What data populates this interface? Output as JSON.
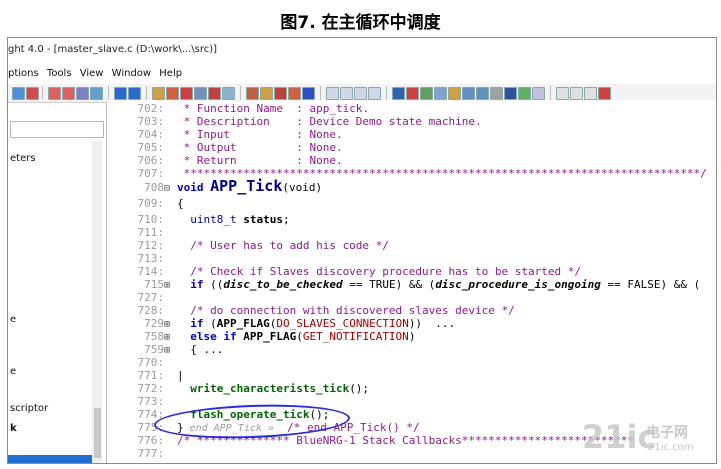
{
  "figure_caption": "图7. 在主循环中调度",
  "window": {
    "title": "ght 4.0 - [master_slave.c (D:\\work\\...\\src)]"
  },
  "menu": [
    "ptions",
    "Tools",
    "View",
    "Window",
    "Help"
  ],
  "sidebar": {
    "labels": [
      "eters",
      "e",
      "e",
      "scriptor",
      "k"
    ]
  },
  "code_lines": [
    {
      "num": "702:",
      "fold": "",
      "text": " * Function Name  : app_tick."
    },
    {
      "num": "703:",
      "fold": "",
      "text": " * Description    : Device Demo state machine."
    },
    {
      "num": "704:",
      "fold": "",
      "text": " * Input          : None."
    },
    {
      "num": "705:",
      "fold": "",
      "text": " * Output         : None."
    },
    {
      "num": "706:",
      "fold": "",
      "text": " * Return         : None."
    },
    {
      "num": "707:",
      "fold": "",
      "text": " ******************************************************************************/"
    },
    {
      "num": "708",
      "fold": "⊟",
      "pre": "void ",
      "fn": "APP_Tick",
      "post": "(void)"
    },
    {
      "num": "709:",
      "fold": "",
      "text": "{"
    },
    {
      "num": "710:",
      "fold": "",
      "pre": "  uint8_t ",
      "bold": "status",
      "post": ";"
    },
    {
      "num": "711:",
      "fold": "",
      "text": ""
    },
    {
      "num": "712:",
      "fold": "",
      "text": "  /* User has to add his code */"
    },
    {
      "num": "713:",
      "fold": "",
      "text": ""
    },
    {
      "num": "714:",
      "fold": "",
      "text": "  /* Check if Slaves discovery procedure has to be started */"
    },
    {
      "num": "715",
      "fold": "⊞",
      "kw": "  if ",
      "a": "((",
      "it1": "disc_to_be_checked",
      "b": " == TRUE) && (",
      "it2": "disc_procedure_is_ongoing",
      "c": " == FALSE) && ("
    },
    {
      "num": "727:",
      "fold": "",
      "text": ""
    },
    {
      "num": "728:",
      "fold": "",
      "text": "  /* do connection with discovered slaves device */"
    },
    {
      "num": "729",
      "fold": "⊞",
      "kw": "  if ",
      "a": "(",
      "fn1": "APP_FLAG",
      "b": "(",
      "mac1": "DO_SLAVES_CONNECTION",
      "c": "))  ..."
    },
    {
      "num": "758",
      "fold": "⊞",
      "kw": "  else if ",
      "fn1": "APP_FLAG",
      "b": "(",
      "mac1": "GET_NOTIFICATION",
      "c": ")"
    },
    {
      "num": "759",
      "fold": "⊞",
      "text": "  { ..."
    },
    {
      "num": "770:",
      "fold": "",
      "text": ""
    },
    {
      "num": "771:",
      "fold": "",
      "text": "|"
    },
    {
      "num": "772:",
      "fold": "",
      "green": "  write_characterists_tick",
      "post": "();"
    },
    {
      "num": "773:",
      "fold": "",
      "text": ""
    },
    {
      "num": "774:",
      "fold": "",
      "green": "  flash_operate_tick",
      "post": "();"
    },
    {
      "num": "775:",
      "fold": "",
      "text": "}",
      "ann": " end APP_Tick »",
      "cm2": "  /* end APP_Tick() */"
    },
    {
      "num": "776:",
      "fold": "",
      "text": "/* ************** BlueNRG-1 Stack Callbacks**************************"
    },
    {
      "num": "777:",
      "fold": "",
      "text": ""
    }
  ],
  "watermark": {
    "main": "21ic",
    "sub": "电子网",
    "small": "21ic.com"
  }
}
